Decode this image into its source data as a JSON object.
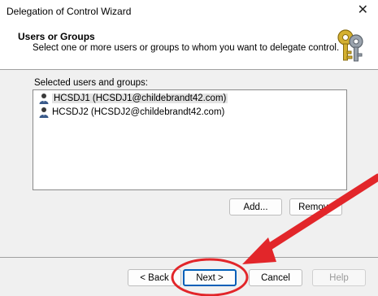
{
  "window": {
    "title": "Delegation of Control Wizard",
    "close_glyph": "✕"
  },
  "header": {
    "title": "Users or Groups",
    "subtitle": "Select one or more users or groups to whom you want to delegate control."
  },
  "list": {
    "label": "Selected users and groups:",
    "items": [
      {
        "text": "HCSDJ1 (HCSDJ1@childebrandt42.com)",
        "selected": true
      },
      {
        "text": "HCSDJ2 (HCSDJ2@childebrandt42.com)",
        "selected": false
      }
    ]
  },
  "buttons": {
    "add": "Add...",
    "remove": "Remove",
    "back": "< Back",
    "next": "Next >",
    "cancel": "Cancel",
    "help": "Help"
  },
  "colors": {
    "annotation": "#e2262a",
    "accent": "#005fb8"
  }
}
